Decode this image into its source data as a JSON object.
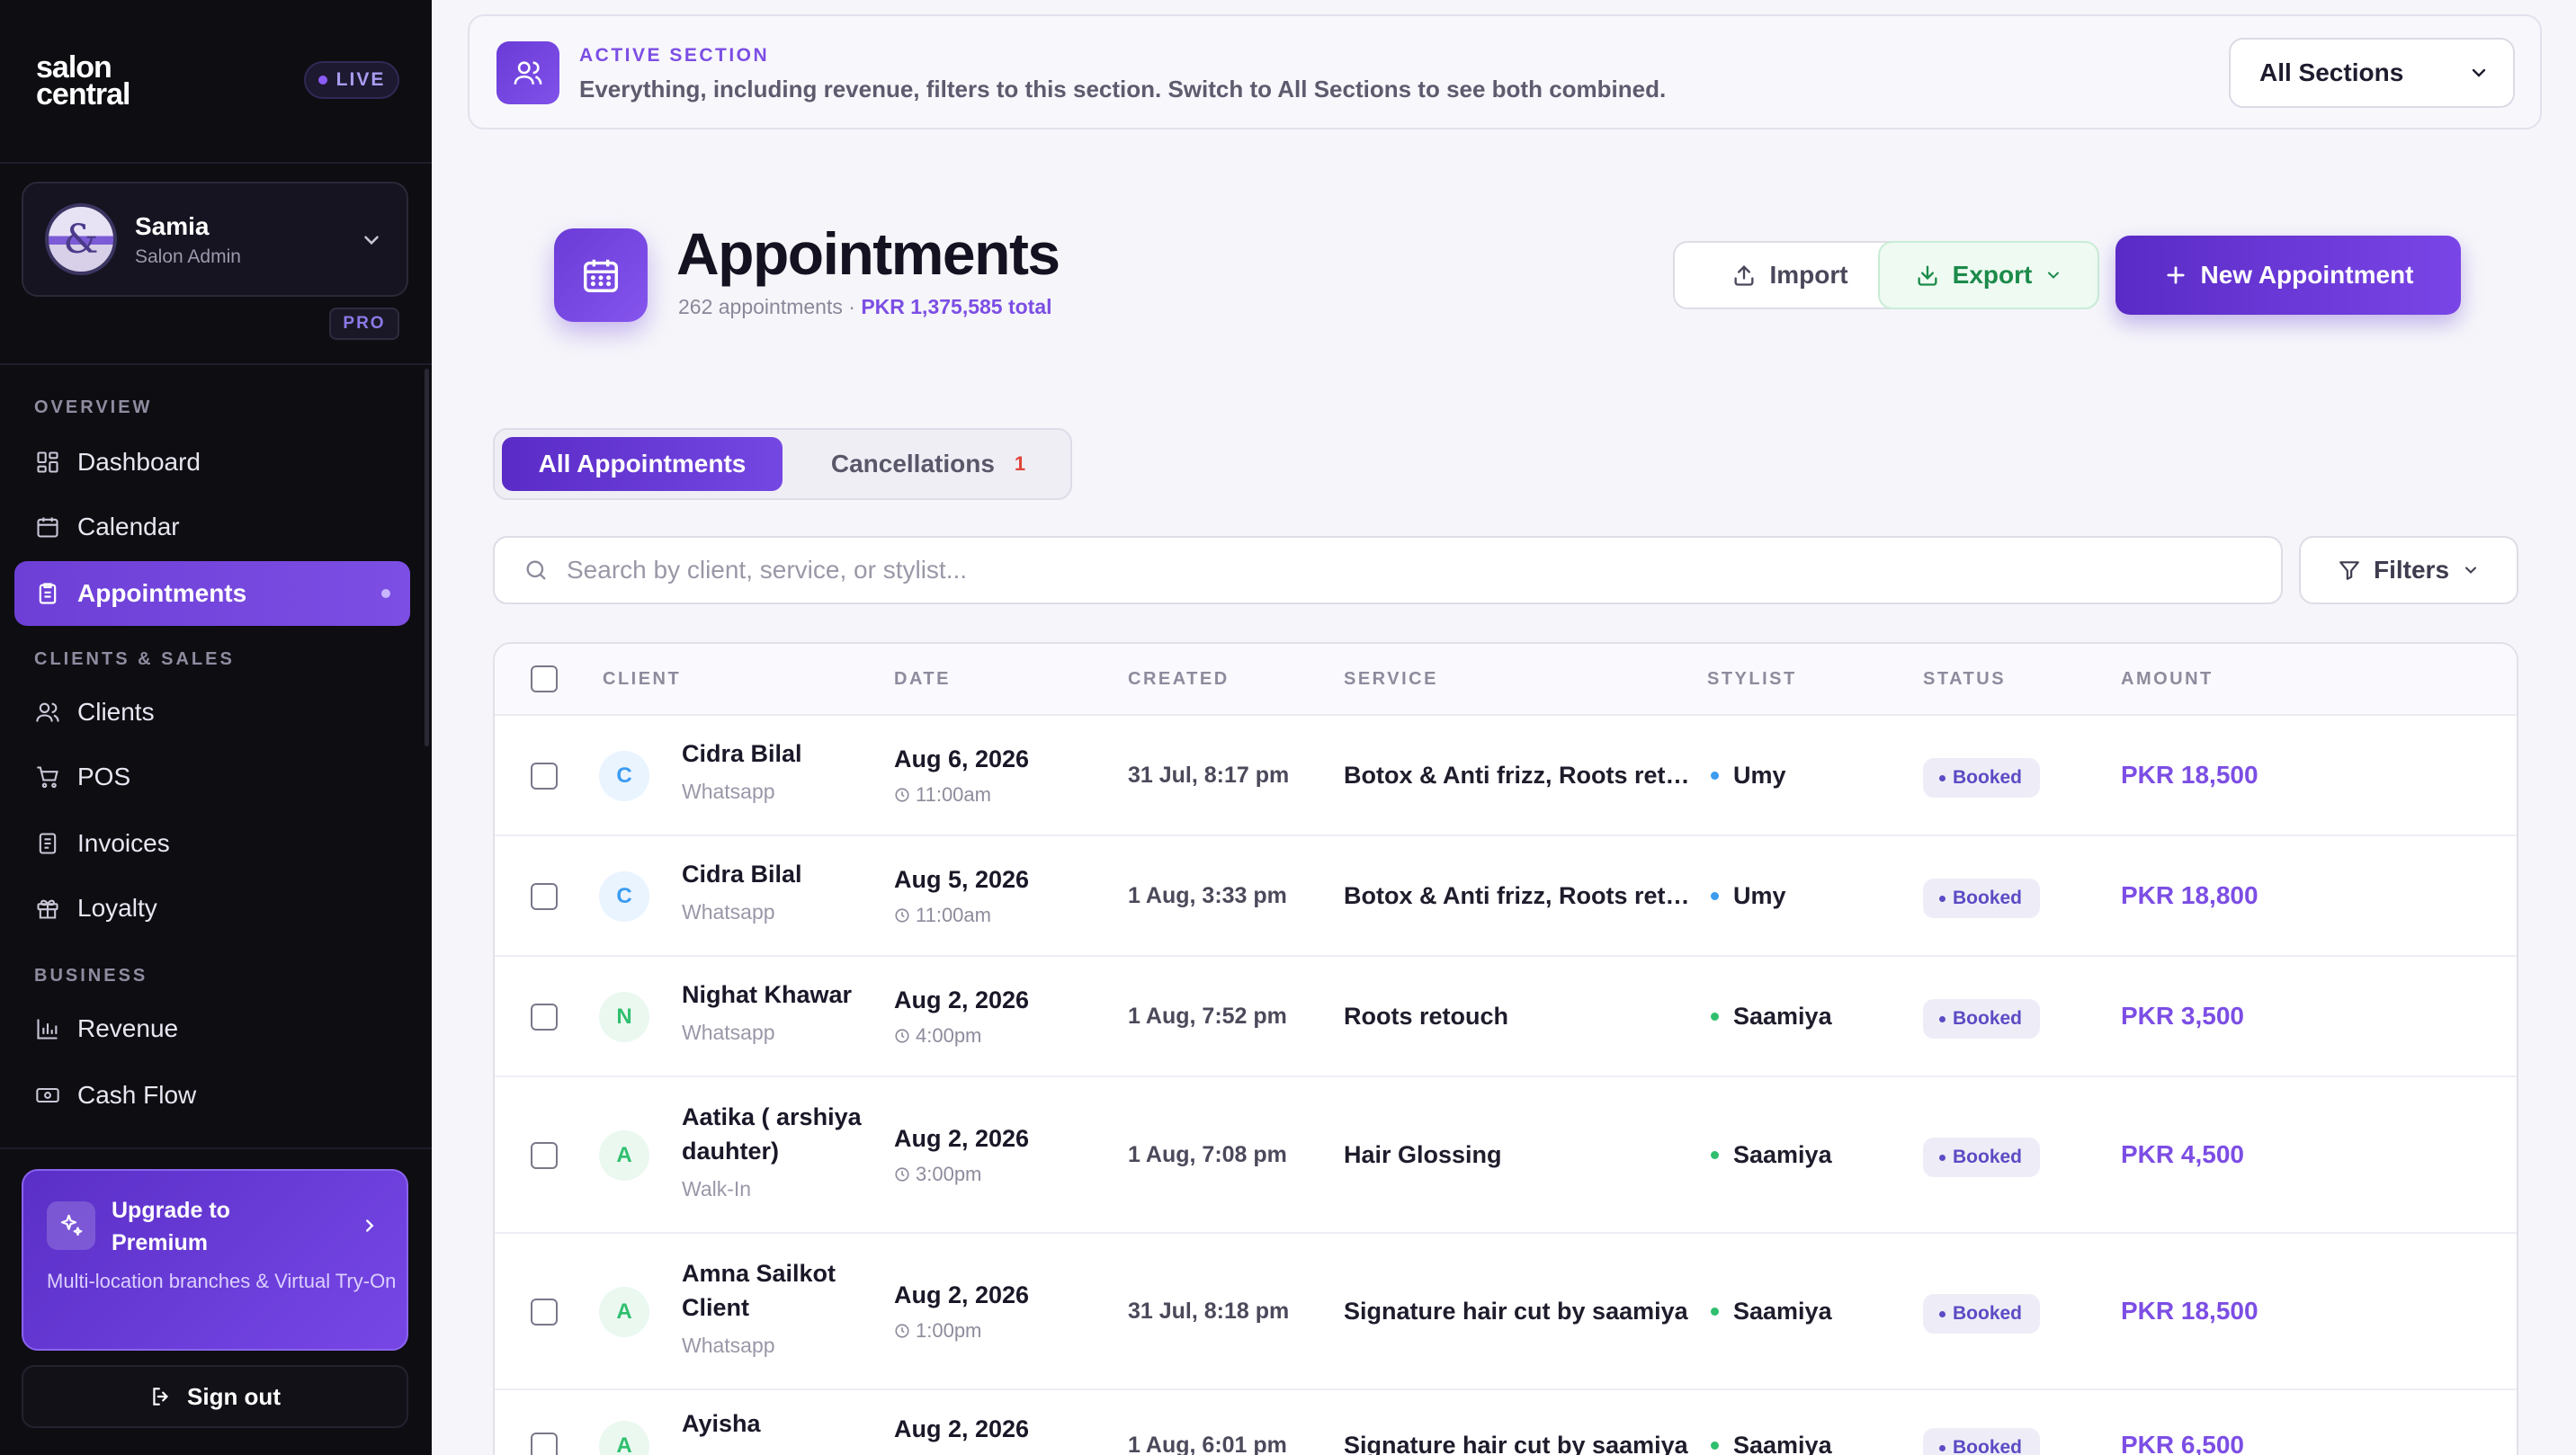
{
  "colors": {
    "accent": "#6d3fd6",
    "sidebar_bg": "#0e0d12",
    "amount": "#7c4ee4",
    "export_green": "#1c8a4a",
    "cancel_count": "#e0453a"
  },
  "sidebar": {
    "brand": "salon central",
    "live_badge": "LIVE",
    "user": {
      "name": "Samia",
      "role": "Salon Admin"
    },
    "plan_badge": "PRO",
    "sections": {
      "overview": "OVERVIEW",
      "clients_sales": "CLIENTS & SALES",
      "business": "BUSINESS"
    },
    "nav": [
      {
        "label": "Dashboard",
        "icon": "grid-icon"
      },
      {
        "label": "Calendar",
        "icon": "calendar-icon"
      },
      {
        "label": "Appointments",
        "icon": "clipboard-icon",
        "active": true
      },
      {
        "label": "Clients",
        "icon": "users-icon"
      },
      {
        "label": "POS",
        "icon": "cart-icon"
      },
      {
        "label": "Invoices",
        "icon": "receipt-icon"
      },
      {
        "label": "Loyalty",
        "icon": "gift-icon"
      },
      {
        "label": "Revenue",
        "icon": "bar-chart-icon"
      },
      {
        "label": "Cash Flow",
        "icon": "cash-icon"
      }
    ],
    "upgrade": {
      "title": "Upgrade to Premium",
      "desc": "Multi-location branches & Virtual Try-On"
    },
    "sign_out": "Sign out"
  },
  "banner": {
    "title": "ACTIVE SECTION",
    "text": "Everything, including revenue, filters to this section. Switch to All Sections to see both combined.",
    "select_value": "All Sections"
  },
  "header": {
    "title": "Appointments",
    "count_text": "262 appointments",
    "separator": " · ",
    "total_text": "PKR 1,375,585 total",
    "import_label": "Import",
    "export_label": "Export",
    "new_label": "New Appointment"
  },
  "tabs": {
    "all": "All Appointments",
    "cancellations": "Cancellations",
    "cancellations_count": "1"
  },
  "search": {
    "placeholder": "Search by client, service, or stylist...",
    "value": ""
  },
  "filters_label": "Filters",
  "table": {
    "columns": [
      "CLIENT",
      "DATE",
      "CREATED",
      "SERVICE",
      "STYLIST",
      "STATUS",
      "AMOUNT"
    ],
    "rows": [
      {
        "initial": "C",
        "name": "Cidra Bilal",
        "source": "Whatsapp",
        "date": "Aug 6, 2026",
        "time": "11:00am",
        "created": "31 Jul, 8:17 pm",
        "service": "Botox & Anti frizz, Roots retouch",
        "stylist": "Umy",
        "stylist_color": "#3b9cf0",
        "status": "Booked",
        "amount": "PKR 18,500",
        "avatar_color": "#3b9cf0",
        "avatar_bg": "#eaf4fe"
      },
      {
        "initial": "C",
        "name": "Cidra Bilal",
        "source": "Whatsapp",
        "date": "Aug 5, 2026",
        "time": "11:00am",
        "created": "1 Aug, 3:33 pm",
        "service": "Botox & Anti frizz, Roots retouch",
        "stylist": "Umy",
        "stylist_color": "#3b9cf0",
        "status": "Booked",
        "amount": "PKR 18,800",
        "avatar_color": "#3b9cf0",
        "avatar_bg": "#eaf4fe"
      },
      {
        "initial": "N",
        "name": "Nighat Khawar",
        "source": "Whatsapp",
        "date": "Aug 2, 2026",
        "time": "4:00pm",
        "created": "1 Aug, 7:52 pm",
        "service": "Roots retouch",
        "stylist": "Saamiya",
        "stylist_color": "#2fbf6e",
        "status": "Booked",
        "amount": "PKR 3,500",
        "avatar_color": "#2fbf6e",
        "avatar_bg": "#eaf8f0"
      },
      {
        "initial": "A",
        "name": "Aatika ( arshiya dauhter)",
        "source": "Walk-In",
        "date": "Aug 2, 2026",
        "time": "3:00pm",
        "created": "1 Aug, 7:08 pm",
        "service": "Hair Glossing",
        "stylist": "Saamiya",
        "stylist_color": "#2fbf6e",
        "status": "Booked",
        "amount": "PKR 4,500",
        "avatar_color": "#2fbf6e",
        "avatar_bg": "#eaf8f0"
      },
      {
        "initial": "A",
        "name": "Amna Sailkot Client",
        "source": "Whatsapp",
        "date": "Aug 2, 2026",
        "time": "1:00pm",
        "created": "31 Jul, 8:18 pm",
        "service": "Signature hair cut by saamiya",
        "stylist": "Saamiya",
        "stylist_color": "#2fbf6e",
        "status": "Booked",
        "amount": "PKR 18,500",
        "avatar_color": "#2fbf6e",
        "avatar_bg": "#eaf8f0"
      },
      {
        "initial": "A",
        "name": "Ayisha",
        "source": "",
        "date": "Aug 2, 2026",
        "time": "",
        "created": "1 Aug, 6:01 pm",
        "service": "Signature hair cut by saamiya",
        "stylist": "Saamiya",
        "stylist_color": "#2fbf6e",
        "status": "Booked",
        "amount": "PKR 6,500",
        "avatar_color": "#2fbf6e",
        "avatar_bg": "#eaf8f0"
      }
    ]
  }
}
